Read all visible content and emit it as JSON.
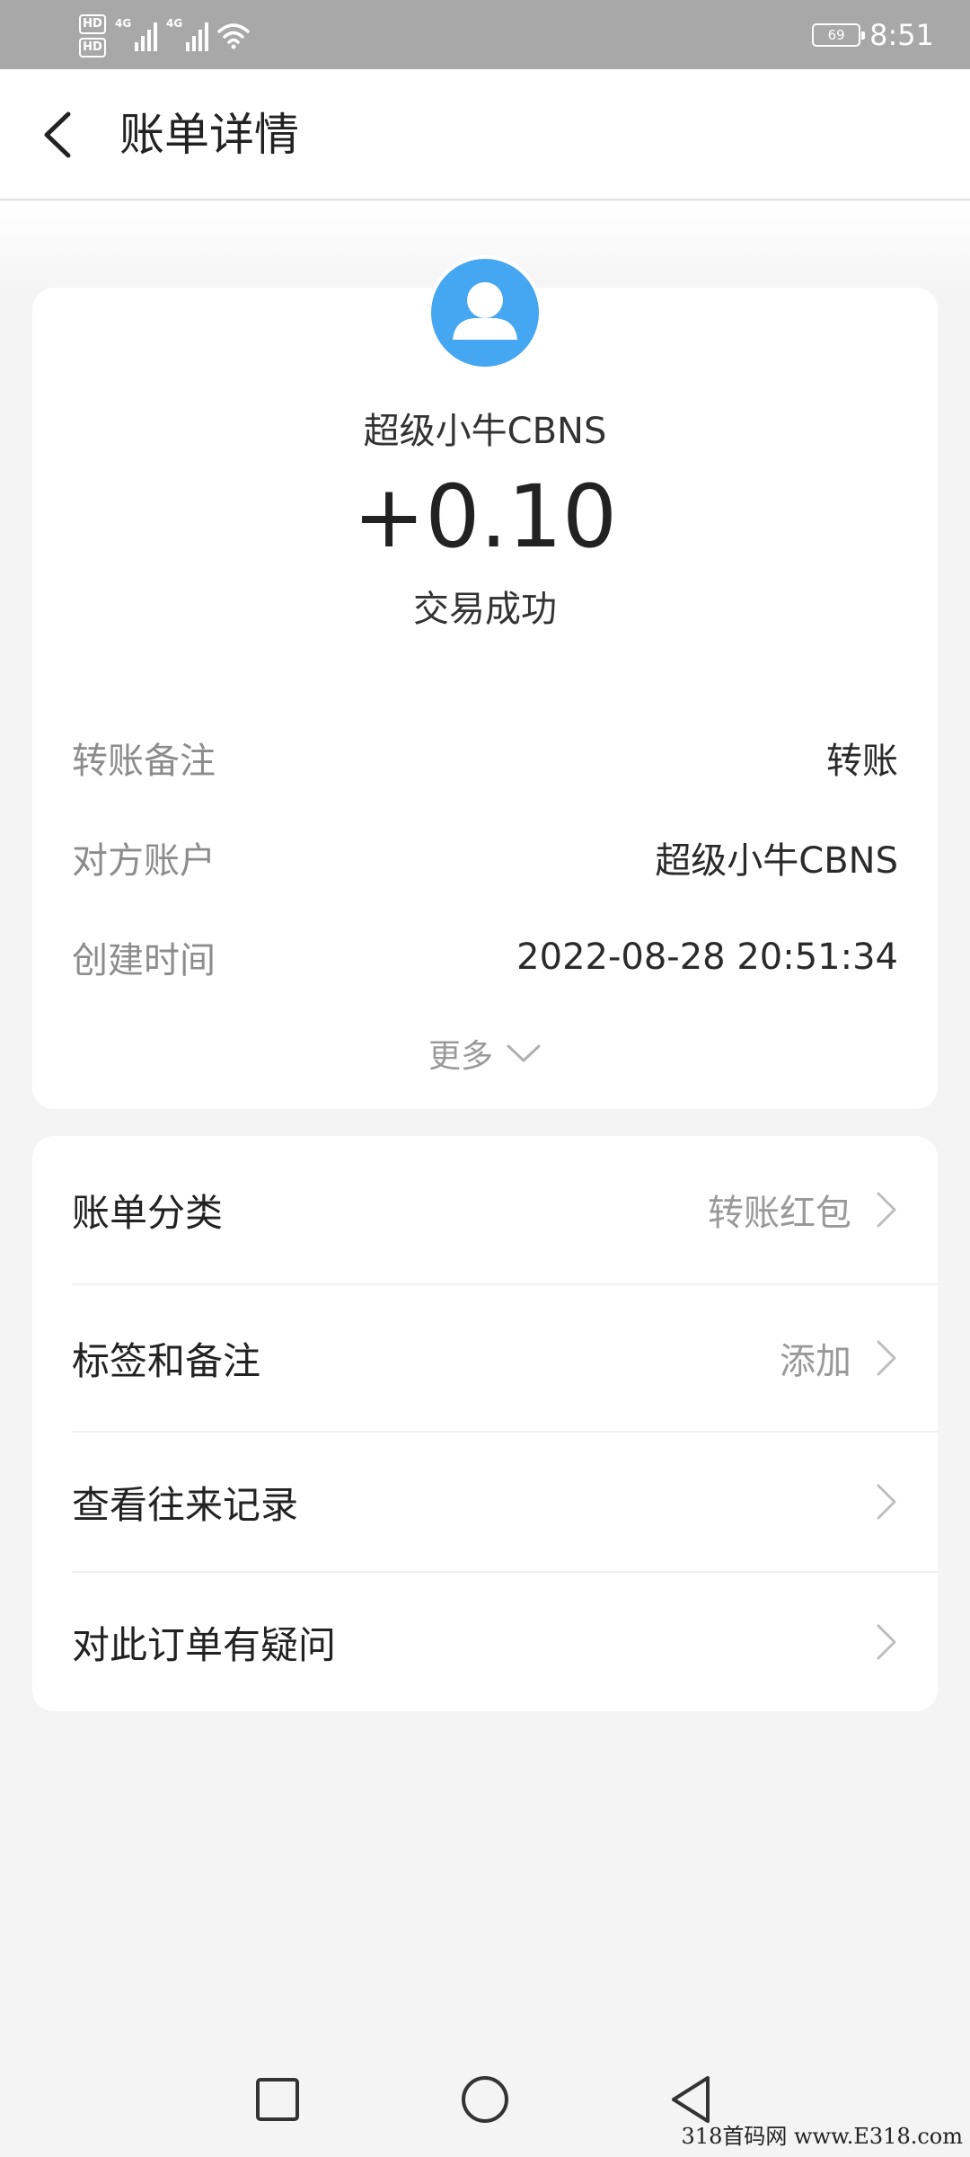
{
  "status_bar": {
    "hd1": "HD",
    "hd2": "HD",
    "net1": "4G",
    "net2": "4G",
    "battery": "69",
    "time": "8:51"
  },
  "header": {
    "title": "账单详情",
    "back_icon": "chevron-left-icon"
  },
  "summary": {
    "avatar_icon": "user-avatar-icon",
    "avatar_color": "#45a7f2",
    "counterparty": "超级小牛CBNS",
    "amount": "+0.10",
    "status": "交易成功"
  },
  "details": [
    {
      "label": "转账备注",
      "value": "转账"
    },
    {
      "label": "对方账户",
      "value": "超级小牛CBNS"
    },
    {
      "label": "创建时间",
      "value": "2022-08-28 20:51:34"
    }
  ],
  "more": {
    "label": "更多"
  },
  "actions": [
    {
      "label": "账单分类",
      "value": "转账红包"
    },
    {
      "label": "标签和备注",
      "value": "添加"
    },
    {
      "label": "查看往来记录",
      "value": ""
    },
    {
      "label": "对此订单有疑问",
      "value": ""
    }
  ],
  "watermark": "318首码网 www.E318.com"
}
